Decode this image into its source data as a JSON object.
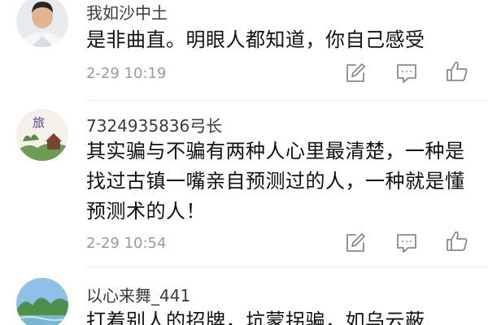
{
  "comments": [
    {
      "username": "我如沙中土",
      "text": "是非曲直。明眼人都知道，你自己感受",
      "time": "2-29 10:19"
    },
    {
      "username": "7324935836弓长",
      "text": "其实骗与不骗有两种人心里最清楚，一种是找过古镇一嘴亲自预测过的人，一种就是懂预测术的人！",
      "avatar_text": "旅",
      "time": "2-29 10:54"
    },
    {
      "username": "以心来舞_441",
      "text": "打着别人的招牌，坑蒙拐骗，如乌云蔽"
    }
  ],
  "icons": [
    "edit-icon",
    "comment-icon",
    "like-icon"
  ],
  "colors": {
    "username": "#3b3b3b",
    "text": "#111111",
    "timestamp": "#9a9a9a",
    "icon": "#8a8a8a",
    "divider": "#ececec"
  }
}
